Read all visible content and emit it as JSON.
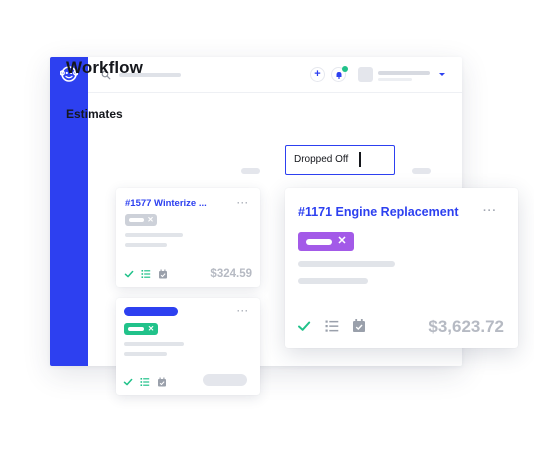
{
  "app": {
    "page_title": "Workflow",
    "column_title": "Estimates",
    "add_symbol": "+"
  },
  "colors": {
    "brand_blue": "#2d40f0",
    "success_green": "#21c28a",
    "tag_green": "#21c28a",
    "tag_purple": "#a35ae8",
    "tag_grey": "#cdd1d9"
  },
  "icons": {
    "logo": "monkey-logo-icon",
    "search": "search-icon",
    "notifications": "bell-icon",
    "more": "more-dots-icon",
    "check": "check-icon",
    "list": "list-icon",
    "calendar": "calendar-icon",
    "remove_tag": "close-icon"
  },
  "status_input": {
    "value": "Dropped Off"
  },
  "cards": {
    "winterize": {
      "title": "#1577 Winterize ...",
      "amount": "$324.59",
      "more": "···",
      "tag_close": "✕"
    },
    "second": {
      "more": "···",
      "tag_close": "✕"
    },
    "engine": {
      "title": "#1171 Engine Replacement",
      "amount": "$3,623.72",
      "more": "···",
      "tag_close": "✕"
    }
  }
}
